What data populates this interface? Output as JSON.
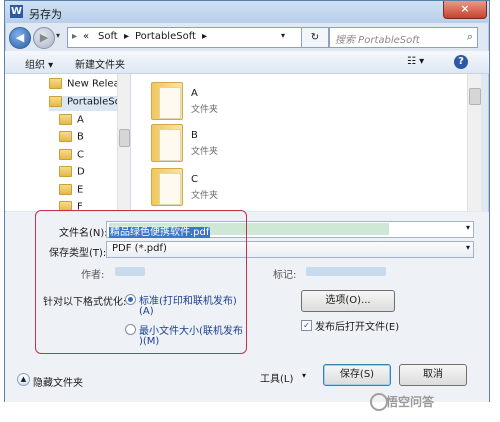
{
  "window": {
    "title": "另存为",
    "app_icon": "W",
    "close_label": "×"
  },
  "nav": {
    "back_icon": "◀",
    "forward_icon": "▶",
    "address_chevron": "«",
    "breadcrumb": [
      "Soft",
      "PortableSoft"
    ],
    "refresh_icon": "↻",
    "search_placeholder": "搜索 PortableSoft",
    "search_icon": "⌕"
  },
  "toolbar": {
    "organize": "组织 ▾",
    "new_folder": "新建文件夹",
    "view_icon": "☷ ▾",
    "help": "?"
  },
  "sidebar": {
    "items": [
      {
        "label": "New Releas",
        "indent": 0
      },
      {
        "label": "PortableSof",
        "indent": 0
      },
      {
        "label": "A",
        "indent": 1
      },
      {
        "label": "B",
        "indent": 1
      },
      {
        "label": "C",
        "indent": 1
      },
      {
        "label": "D",
        "indent": 1
      },
      {
        "label": "E",
        "indent": 1
      },
      {
        "label": "F",
        "indent": 1
      }
    ]
  },
  "files": [
    {
      "name": "A",
      "type": "文件夹"
    },
    {
      "name": "B",
      "type": "文件夹"
    },
    {
      "name": "C",
      "type": "文件夹"
    }
  ],
  "form": {
    "filename_label": "文件名(N):",
    "filename_value": "精品绿色便携软件.pdf",
    "savetype_label": "保存类型(T):",
    "savetype_value": "PDF (*.pdf)",
    "author_label": "作者:",
    "tags_label": "标记:",
    "optimize_label": "针对以下格式优化:",
    "option1": "标准(打印和联机发布)",
    "option1_key": "(A)",
    "option2": "最小文件大小(联机发布",
    "option2_key": ")(M)",
    "options_button": "选项(O)...",
    "open_after_label": "发布后打开文件(E)",
    "open_after_checked": true
  },
  "footer": {
    "hide_folders": "隐藏文件夹",
    "tools": "工具(L)",
    "save": "保存(S)",
    "cancel": "取消"
  },
  "watermark": "悟空问答"
}
